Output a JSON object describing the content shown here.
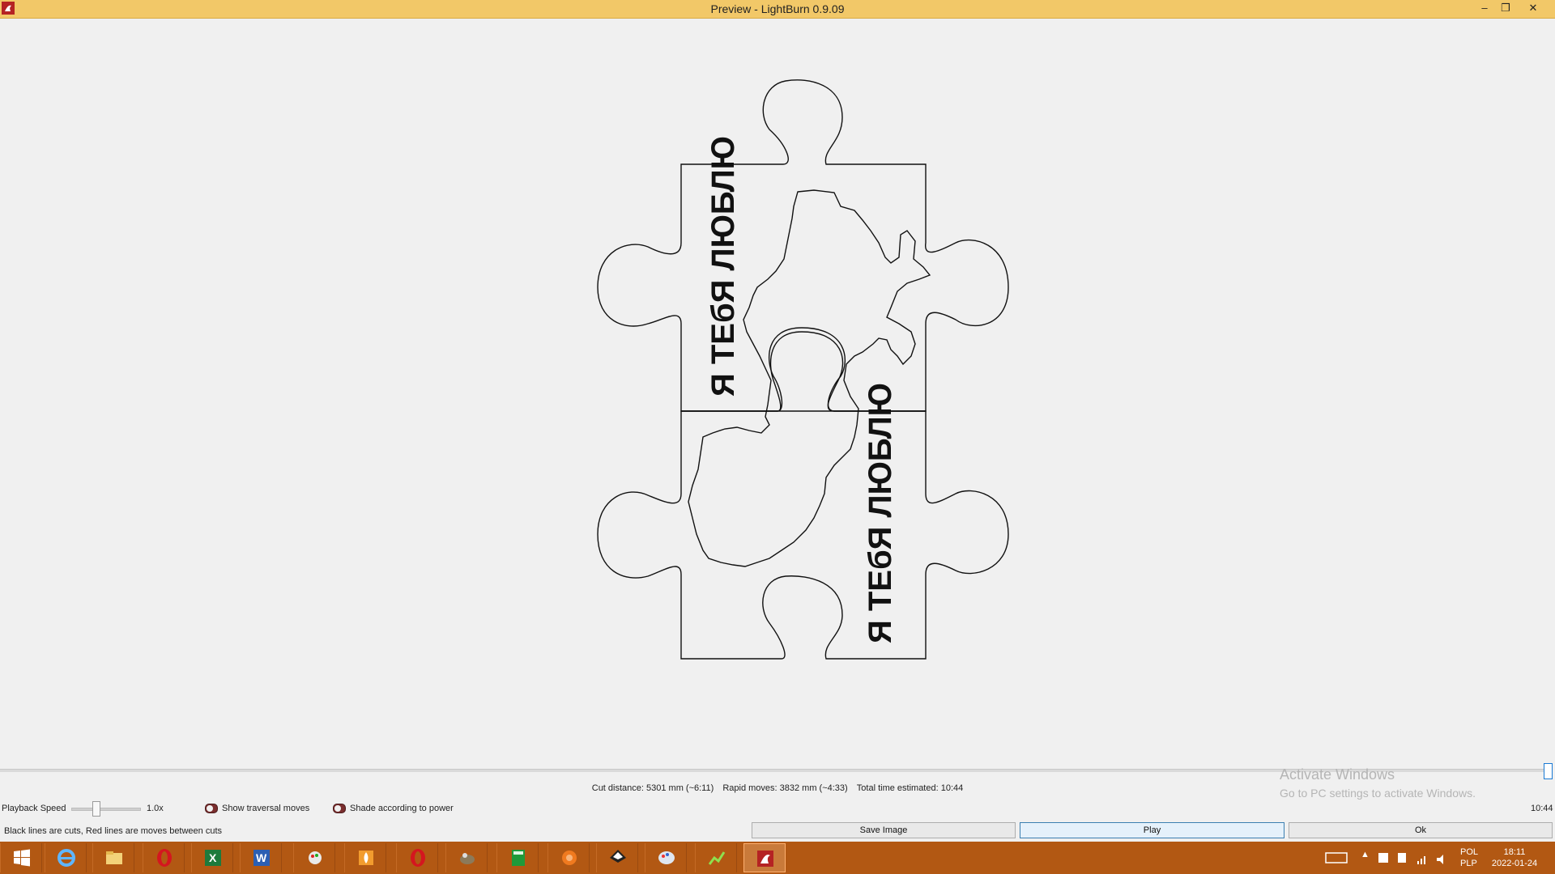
{
  "window": {
    "title": "Preview - LightBurn 0.9.09",
    "minimize_label": "–",
    "restore_label": "❐",
    "close_label": "✕"
  },
  "canvas": {
    "text_top": "Я ТЕбЯ ЛЮБЛЮ",
    "text_bottom": "Я ТЕбЯ ЛЮБЛЮ"
  },
  "stats": {
    "cut_distance": "Cut distance: 5301 mm (~6:11)",
    "rapid_moves": "Rapid moves: 3832 mm (~4:33)",
    "total_time": "Total time estimated: 10:44"
  },
  "controls": {
    "playback_speed_label": "Playback Speed",
    "playback_speed_value": "1.0x",
    "show_traversal_label": "Show traversal moves",
    "shade_power_label": "Shade according to power",
    "time_readout": "10:44",
    "hint": "Black lines are cuts, Red lines are moves between cuts"
  },
  "buttons": {
    "save_image": "Save Image",
    "play": "Play",
    "ok": "Ok"
  },
  "watermark": {
    "line1": "Activate Windows",
    "line2": "Go to PC settings to activate Windows."
  },
  "taskbar": {
    "apps": [
      "start-icon",
      "ie-icon",
      "file-explorer-icon",
      "opera-icon",
      "excel-icon",
      "word-icon",
      "paint-icon",
      "flame-app-icon",
      "opera-icon",
      "gimp-icon",
      "calculator-icon",
      "orange-app-icon",
      "inkscape-icon",
      "palette-app-icon",
      "graph-app-icon",
      "lightburn-icon"
    ],
    "language": "POL",
    "layout": "PLP",
    "time": "18:11",
    "date": "2022-01-24"
  },
  "colors": {
    "titlebar": "#f2c868",
    "taskbar": "#b25813",
    "toggle": "#7a2e2e"
  }
}
